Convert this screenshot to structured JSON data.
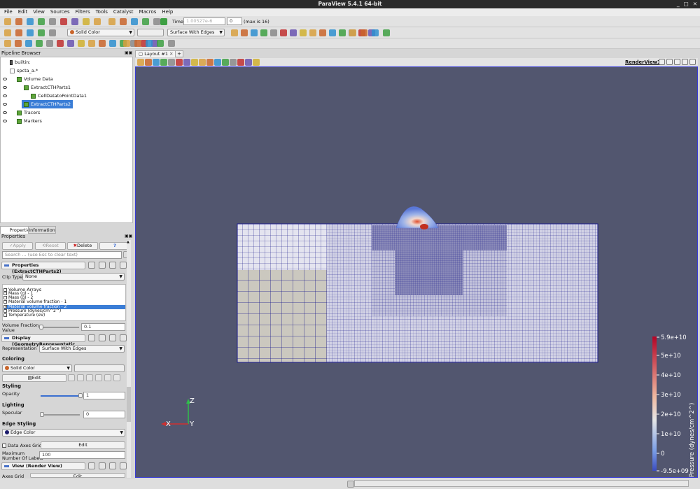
{
  "window": {
    "title": "ParaView 5.4.1 64-bit"
  },
  "menu": [
    "File",
    "Edit",
    "View",
    "Sources",
    "Filters",
    "Tools",
    "Catalyst",
    "Macros",
    "Help"
  ],
  "toolbar": {
    "time_label": "Time:",
    "time_value": "1.00527e-6",
    "timestep": "0",
    "max_label": "(max is 16)",
    "coloring_select": "Solid Color",
    "representation_select": "Surface With Edges"
  },
  "pipeline": {
    "title": "Pipeline Browser",
    "items": [
      {
        "label": "builtin:",
        "level": 0
      },
      {
        "label": "spcta_a.*",
        "level": 0
      },
      {
        "label": "Volume Data",
        "level": 1
      },
      {
        "label": "ExtractCTHParts1",
        "level": 2
      },
      {
        "label": "CellDatatoPointData1",
        "level": 3
      },
      {
        "label": "ExtractCTHParts2",
        "level": 2,
        "selected": true
      },
      {
        "label": "Tracers",
        "level": 1
      },
      {
        "label": "Markers",
        "level": 1
      }
    ]
  },
  "props": {
    "tabs": [
      "Properties",
      "Information"
    ],
    "panel_title": "Properties",
    "apply": "Apply",
    "reset": "Reset",
    "delete": "Delete",
    "help": "?",
    "search_placeholder": "Search ... (use Esc to clear text)",
    "section_props": "Properties (ExtractCTHParts2)",
    "clip_type_label": "Clip Type",
    "clip_type_value": "None",
    "volume_arrays_header": "Volume Arrays",
    "arrays": [
      {
        "label": "Mass (g) - 1",
        "checked": false
      },
      {
        "label": "Mass (g) - 2",
        "checked": false
      },
      {
        "label": "Material volume fraction - 1",
        "checked": false
      },
      {
        "label": "Material volume fraction - 2",
        "checked": true,
        "selected": true
      },
      {
        "label": "Pressure (dynes/cm^2^)",
        "checked": false
      },
      {
        "label": "Temperature (eV)",
        "checked": false
      }
    ],
    "vf_label_1": "Volume Fraction",
    "vf_label_2": "Value",
    "vf_value": "0.1",
    "section_display": "Display (GeometryRepresentatic",
    "representation_label": "Representation",
    "representation_value": "Surface With Edges",
    "coloring_label": "Coloring",
    "coloring_value": "Solid Color",
    "edit_label": "Edit",
    "styling_label": "Styling",
    "opacity_label": "Opacity",
    "opacity_value": "1",
    "lighting_label": "Lighting",
    "specular_label": "Specular",
    "specular_value": "0",
    "edge_styling_label": "Edge Styling",
    "edge_color_label": "Edge Color",
    "data_axes_grid_label": "Data Axes Grid",
    "data_axes_edit": "Edit",
    "max_labels_1": "Maximum",
    "max_labels_2": "Number Of Labels",
    "max_labels_value": "100",
    "section_view": "View (Render View)",
    "axes_grid_label": "Axes Grid",
    "axes_grid_edit": "Edit"
  },
  "layout": {
    "tab_label": "Layout #1",
    "add_tab": "+",
    "view_label": "RenderView1"
  },
  "legend": {
    "title": "Pressure (dynes/cm^2^)",
    "ticks": [
      "5.9e+10",
      "5e+10",
      "4e+10",
      "3e+10",
      "2e+10",
      "1e+10",
      "0",
      "-9.5e+09"
    ]
  },
  "axes": {
    "z": "Z",
    "x": "X",
    "y": "Y"
  },
  "colors": {
    "background": "#52566f",
    "mesh": "#1a1a8c",
    "fill": "#cbc8bf",
    "accent": "#3a7dd6"
  }
}
